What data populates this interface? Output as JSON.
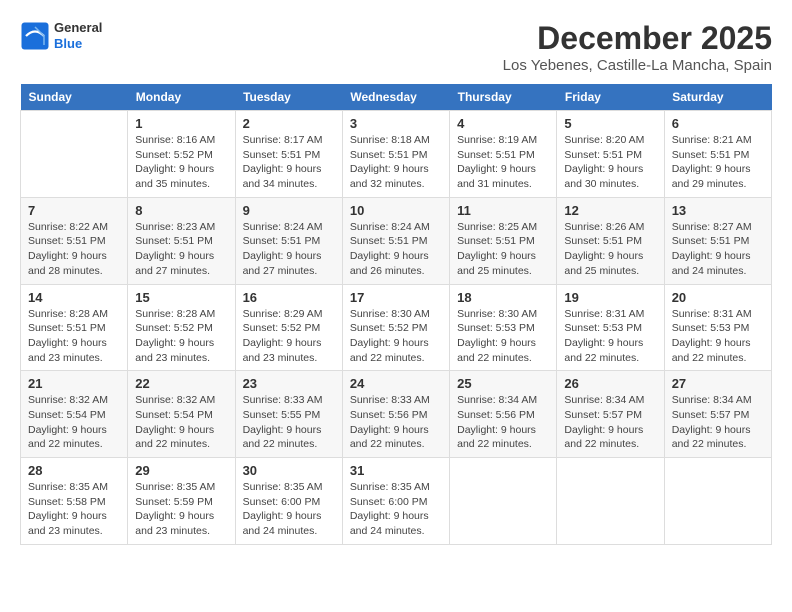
{
  "logo": {
    "general": "General",
    "blue": "Blue"
  },
  "title": "December 2025",
  "subtitle": "Los Yebenes, Castille-La Mancha, Spain",
  "headers": [
    "Sunday",
    "Monday",
    "Tuesday",
    "Wednesday",
    "Thursday",
    "Friday",
    "Saturday"
  ],
  "weeks": [
    [
      {
        "day": "",
        "sunrise": "",
        "sunset": "",
        "daylight": ""
      },
      {
        "day": "1",
        "sunrise": "Sunrise: 8:16 AM",
        "sunset": "Sunset: 5:52 PM",
        "daylight": "Daylight: 9 hours and 35 minutes."
      },
      {
        "day": "2",
        "sunrise": "Sunrise: 8:17 AM",
        "sunset": "Sunset: 5:51 PM",
        "daylight": "Daylight: 9 hours and 34 minutes."
      },
      {
        "day": "3",
        "sunrise": "Sunrise: 8:18 AM",
        "sunset": "Sunset: 5:51 PM",
        "daylight": "Daylight: 9 hours and 32 minutes."
      },
      {
        "day": "4",
        "sunrise": "Sunrise: 8:19 AM",
        "sunset": "Sunset: 5:51 PM",
        "daylight": "Daylight: 9 hours and 31 minutes."
      },
      {
        "day": "5",
        "sunrise": "Sunrise: 8:20 AM",
        "sunset": "Sunset: 5:51 PM",
        "daylight": "Daylight: 9 hours and 30 minutes."
      },
      {
        "day": "6",
        "sunrise": "Sunrise: 8:21 AM",
        "sunset": "Sunset: 5:51 PM",
        "daylight": "Daylight: 9 hours and 29 minutes."
      }
    ],
    [
      {
        "day": "7",
        "sunrise": "Sunrise: 8:22 AM",
        "sunset": "Sunset: 5:51 PM",
        "daylight": "Daylight: 9 hours and 28 minutes."
      },
      {
        "day": "8",
        "sunrise": "Sunrise: 8:23 AM",
        "sunset": "Sunset: 5:51 PM",
        "daylight": "Daylight: 9 hours and 27 minutes."
      },
      {
        "day": "9",
        "sunrise": "Sunrise: 8:24 AM",
        "sunset": "Sunset: 5:51 PM",
        "daylight": "Daylight: 9 hours and 27 minutes."
      },
      {
        "day": "10",
        "sunrise": "Sunrise: 8:24 AM",
        "sunset": "Sunset: 5:51 PM",
        "daylight": "Daylight: 9 hours and 26 minutes."
      },
      {
        "day": "11",
        "sunrise": "Sunrise: 8:25 AM",
        "sunset": "Sunset: 5:51 PM",
        "daylight": "Daylight: 9 hours and 25 minutes."
      },
      {
        "day": "12",
        "sunrise": "Sunrise: 8:26 AM",
        "sunset": "Sunset: 5:51 PM",
        "daylight": "Daylight: 9 hours and 25 minutes."
      },
      {
        "day": "13",
        "sunrise": "Sunrise: 8:27 AM",
        "sunset": "Sunset: 5:51 PM",
        "daylight": "Daylight: 9 hours and 24 minutes."
      }
    ],
    [
      {
        "day": "14",
        "sunrise": "Sunrise: 8:28 AM",
        "sunset": "Sunset: 5:51 PM",
        "daylight": "Daylight: 9 hours and 23 minutes."
      },
      {
        "day": "15",
        "sunrise": "Sunrise: 8:28 AM",
        "sunset": "Sunset: 5:52 PM",
        "daylight": "Daylight: 9 hours and 23 minutes."
      },
      {
        "day": "16",
        "sunrise": "Sunrise: 8:29 AM",
        "sunset": "Sunset: 5:52 PM",
        "daylight": "Daylight: 9 hours and 23 minutes."
      },
      {
        "day": "17",
        "sunrise": "Sunrise: 8:30 AM",
        "sunset": "Sunset: 5:52 PM",
        "daylight": "Daylight: 9 hours and 22 minutes."
      },
      {
        "day": "18",
        "sunrise": "Sunrise: 8:30 AM",
        "sunset": "Sunset: 5:53 PM",
        "daylight": "Daylight: 9 hours and 22 minutes."
      },
      {
        "day": "19",
        "sunrise": "Sunrise: 8:31 AM",
        "sunset": "Sunset: 5:53 PM",
        "daylight": "Daylight: 9 hours and 22 minutes."
      },
      {
        "day": "20",
        "sunrise": "Sunrise: 8:31 AM",
        "sunset": "Sunset: 5:53 PM",
        "daylight": "Daylight: 9 hours and 22 minutes."
      }
    ],
    [
      {
        "day": "21",
        "sunrise": "Sunrise: 8:32 AM",
        "sunset": "Sunset: 5:54 PM",
        "daylight": "Daylight: 9 hours and 22 minutes."
      },
      {
        "day": "22",
        "sunrise": "Sunrise: 8:32 AM",
        "sunset": "Sunset: 5:54 PM",
        "daylight": "Daylight: 9 hours and 22 minutes."
      },
      {
        "day": "23",
        "sunrise": "Sunrise: 8:33 AM",
        "sunset": "Sunset: 5:55 PM",
        "daylight": "Daylight: 9 hours and 22 minutes."
      },
      {
        "day": "24",
        "sunrise": "Sunrise: 8:33 AM",
        "sunset": "Sunset: 5:56 PM",
        "daylight": "Daylight: 9 hours and 22 minutes."
      },
      {
        "day": "25",
        "sunrise": "Sunrise: 8:34 AM",
        "sunset": "Sunset: 5:56 PM",
        "daylight": "Daylight: 9 hours and 22 minutes."
      },
      {
        "day": "26",
        "sunrise": "Sunrise: 8:34 AM",
        "sunset": "Sunset: 5:57 PM",
        "daylight": "Daylight: 9 hours and 22 minutes."
      },
      {
        "day": "27",
        "sunrise": "Sunrise: 8:34 AM",
        "sunset": "Sunset: 5:57 PM",
        "daylight": "Daylight: 9 hours and 22 minutes."
      }
    ],
    [
      {
        "day": "28",
        "sunrise": "Sunrise: 8:35 AM",
        "sunset": "Sunset: 5:58 PM",
        "daylight": "Daylight: 9 hours and 23 minutes."
      },
      {
        "day": "29",
        "sunrise": "Sunrise: 8:35 AM",
        "sunset": "Sunset: 5:59 PM",
        "daylight": "Daylight: 9 hours and 23 minutes."
      },
      {
        "day": "30",
        "sunrise": "Sunrise: 8:35 AM",
        "sunset": "Sunset: 6:00 PM",
        "daylight": "Daylight: 9 hours and 24 minutes."
      },
      {
        "day": "31",
        "sunrise": "Sunrise: 8:35 AM",
        "sunset": "Sunset: 6:00 PM",
        "daylight": "Daylight: 9 hours and 24 minutes."
      },
      {
        "day": "",
        "sunrise": "",
        "sunset": "",
        "daylight": ""
      },
      {
        "day": "",
        "sunrise": "",
        "sunset": "",
        "daylight": ""
      },
      {
        "day": "",
        "sunrise": "",
        "sunset": "",
        "daylight": ""
      }
    ]
  ]
}
